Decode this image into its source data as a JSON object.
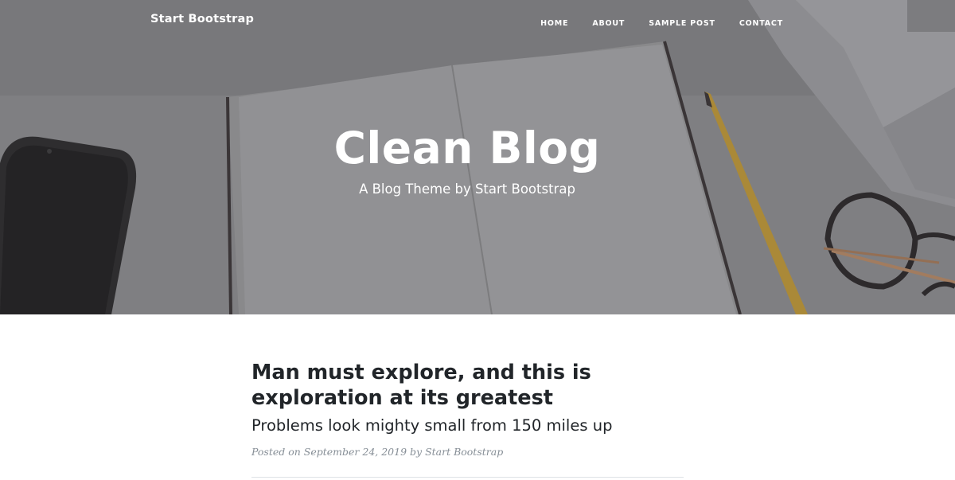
{
  "nav": {
    "brand": "Start Bootstrap",
    "items": [
      {
        "label": "HOME"
      },
      {
        "label": "ABOUT"
      },
      {
        "label": "SAMPLE POST"
      },
      {
        "label": "CONTACT"
      }
    ]
  },
  "header": {
    "title": "Clean Blog",
    "subtitle": "A Blog Theme by Start Bootstrap"
  },
  "posts": [
    {
      "title": "Man must explore, and this is exploration at its greatest",
      "subtitle": "Problems look mighty small from 150 miles up",
      "meta_prefix": "Posted on September 24, 2019 by",
      "author": "Start Bootstrap"
    }
  ],
  "colors": {
    "overlay": "#6c6c6f",
    "text_dark": "#212529",
    "meta": "#868e96"
  }
}
